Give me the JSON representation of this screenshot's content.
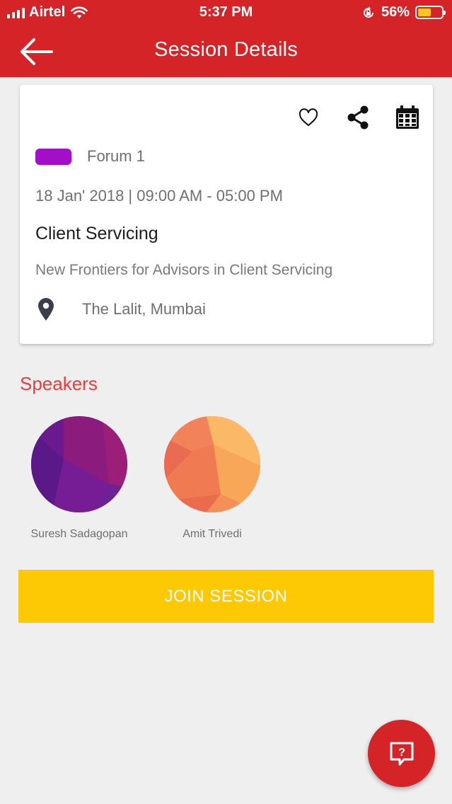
{
  "status_bar": {
    "carrier": "Airtel",
    "time": "5:37 PM",
    "battery_percent": "56%",
    "battery_level": 0.56
  },
  "nav": {
    "title": "Session Details",
    "back_icon": "arrow-left-icon"
  },
  "card": {
    "actions": [
      "heart-icon",
      "share-icon",
      "calendar-icon"
    ],
    "track": {
      "name": "Forum 1",
      "color": "#a30fc9"
    },
    "date_time": "18 Jan' 2018 | 09:00 AM - 05:00 PM",
    "title": "Client Servicing",
    "description": "New Frontiers for Advisors in Client Servicing",
    "location": "The Lalit, Mumbai",
    "location_icon": "map-pin-icon"
  },
  "speakers": {
    "heading": "Speakers",
    "items": [
      {
        "name": "Suresh Sadagopan"
      },
      {
        "name": "Amit Trivedi"
      }
    ]
  },
  "join_button": {
    "label": "JOIN SESSION",
    "color": "#fdc905"
  },
  "fab": {
    "icon": "help-chat-icon"
  },
  "colors": {
    "brand": "#d42427",
    "accent": "#e2403e"
  }
}
